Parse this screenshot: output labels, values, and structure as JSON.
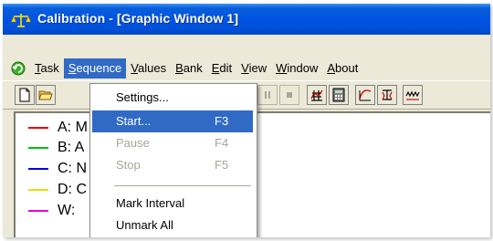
{
  "window": {
    "title": "Calibration - [Graphic Window 1]"
  },
  "menubar": {
    "items": [
      {
        "label": "Task",
        "underline": "T",
        "rest": "ask"
      },
      {
        "label": "Sequence",
        "underline": "S",
        "rest": "equence"
      },
      {
        "label": "Values",
        "underline": "V",
        "rest": "alues"
      },
      {
        "label": "Bank",
        "underline": "B",
        "rest": "ank"
      },
      {
        "label": "Edit",
        "underline": "E",
        "rest": "dit"
      },
      {
        "label": "View",
        "underline": "V",
        "rest": "iew"
      },
      {
        "label": "Window",
        "underline": "W",
        "rest": "indow"
      },
      {
        "label": "About",
        "underline": "A",
        "rest": "bout"
      }
    ]
  },
  "dropdown": {
    "items": [
      {
        "label": "Settings...",
        "shortcut": ""
      },
      {
        "label": "Start...",
        "shortcut": "F3"
      },
      {
        "label": "Pause",
        "shortcut": "F4"
      },
      {
        "label": "Stop",
        "shortcut": "F5"
      },
      {
        "label": "Mark Interval",
        "shortcut": ""
      },
      {
        "label": "Unmark All",
        "shortcut": ""
      }
    ]
  },
  "legend": {
    "items": [
      {
        "label": "A: M",
        "color": "#e60000"
      },
      {
        "label": "B: A",
        "color": "#00c000"
      },
      {
        "label": "C: N",
        "color": "#0000e6"
      },
      {
        "label": "D: C",
        "color": "#e0e000"
      },
      {
        "label": "W:",
        "color": "#e600e6"
      }
    ]
  },
  "icons": {
    "app": "scales-icon",
    "task": "task-icon",
    "toolbar": [
      "new-document-icon",
      "open-folder-icon",
      "pause-icon",
      "stop-icon",
      "chart-grid-icon",
      "calculator-icon",
      "curve-icon",
      "calibration-icon",
      "signal-icon"
    ]
  }
}
